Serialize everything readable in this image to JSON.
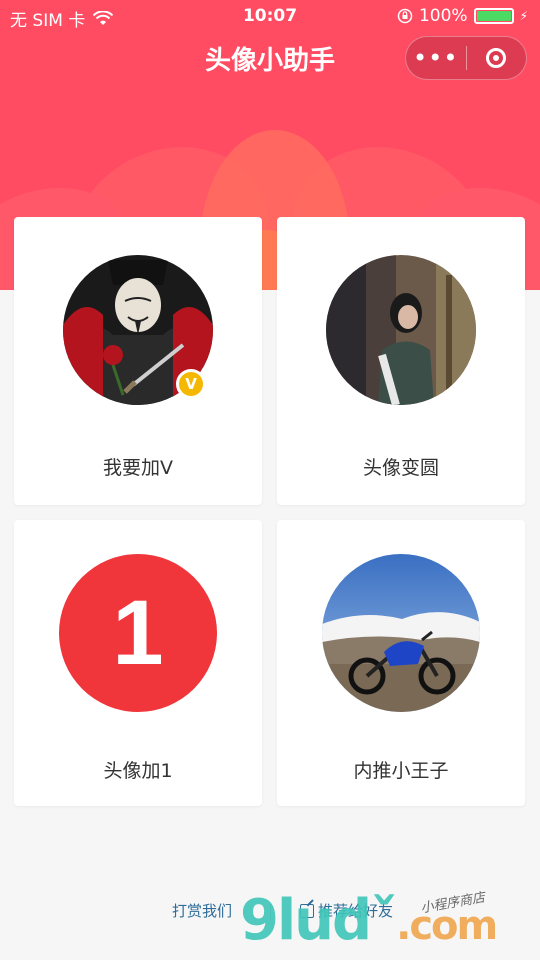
{
  "status": {
    "carrier": "无 SIM 卡",
    "time": "10:07",
    "battery": "100%"
  },
  "nav": {
    "title": "头像小助手"
  },
  "cards": [
    {
      "label": "我要加V",
      "badge": "V"
    },
    {
      "label": "头像变圆"
    },
    {
      "label": "头像加1",
      "number": "1"
    },
    {
      "label": "内推小王子"
    }
  ],
  "footer": {
    "left": "打赏我们",
    "right": "推荐给好友"
  },
  "watermark": {
    "brand": "9ludˇ",
    "com": ".com",
    "tag": "小程序商店"
  },
  "colors": {
    "header": "#ff4c63",
    "badge": "#f5b800",
    "number_circle": "#f0353b",
    "footer_link": "#2e6d9a"
  }
}
